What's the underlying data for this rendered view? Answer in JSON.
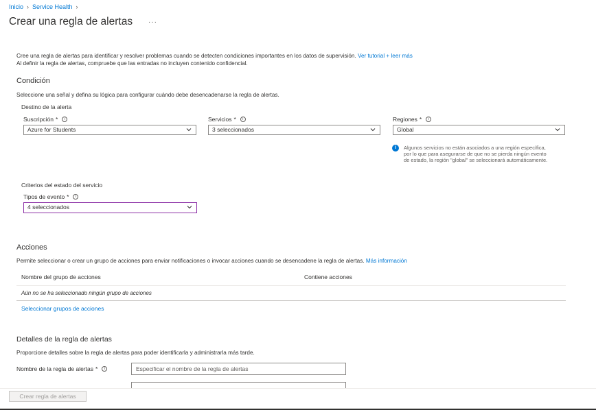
{
  "breadcrumb": [
    "Inicio",
    "Service Health"
  ],
  "page_title": "Crear una regla de alertas",
  "intro": {
    "line1": "Cree una regla de alertas para identificar y resolver problemas cuando se detecten condiciones importantes en los datos de supervisión.",
    "link": "Ver tutorial + leer más",
    "line2": "Al definir la regla de alertas, compruebe que las entradas no incluyen contenido confidencial."
  },
  "condition": {
    "title": "Condición",
    "description": "Seleccione una señal y defina su lógica para configurar cuándo debe desencadenarse la regla de alertas.",
    "target_title": "Destino de la alerta",
    "subscription": {
      "label": "Suscripción",
      "value": "Azure for Students"
    },
    "services": {
      "label": "Servicios",
      "value": "3 seleccionados"
    },
    "regions": {
      "label": "Regiones",
      "value": "Global"
    },
    "regions_note": [
      "Algunos servicios no están asociados a una región específica,",
      "por lo que para asegurarse de que no se pierda ningún evento",
      "de estado, la región \"global\" se seleccionará automáticamente."
    ],
    "criteria_title": "Criterios del estado del servicio",
    "event_types": {
      "label": "Tipos de evento",
      "value": "4 seleccionados"
    }
  },
  "actions": {
    "title": "Acciones",
    "description": "Permite seleccionar o crear un grupo de acciones para enviar notificaciones o invocar acciones cuando se desencadene la regla de alertas.",
    "link": "Más información",
    "col_name": "Nombre del grupo de acciones",
    "col_contains": "Contiene acciones",
    "empty": "Aún no se ha seleccionado ningún grupo de acciones",
    "select_link": "Seleccionar grupos de acciones"
  },
  "details": {
    "title": "Detalles de la regla de alertas",
    "description": "Proporcione detalles sobre la regla de alertas para poder identificarla y administrarla más tarde.",
    "name_label": "Nombre de la regla de alertas",
    "name_placeholder": "Especificar el nombre de la regla de alertas"
  },
  "footer": {
    "create_button": "Crear regla de alertas"
  }
}
